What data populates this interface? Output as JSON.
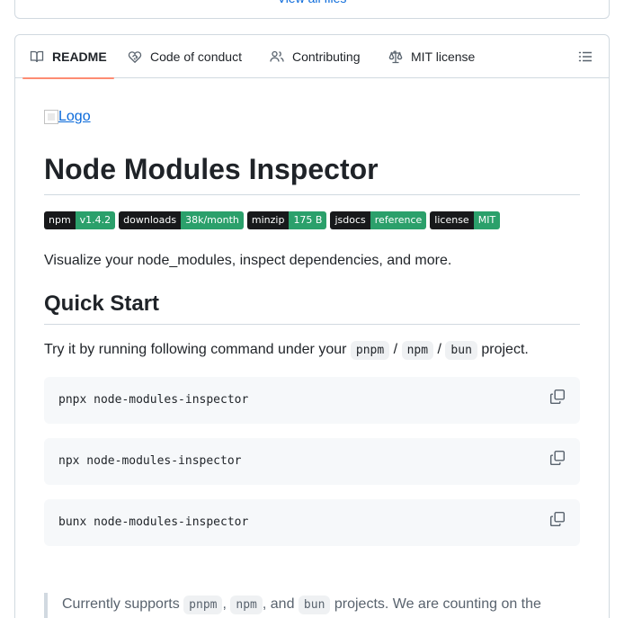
{
  "top": {
    "view_all_files": "View all files"
  },
  "tabs": [
    {
      "label": "README",
      "icon": "book-icon"
    },
    {
      "label": "Code of conduct",
      "icon": "heart-handshake-icon"
    },
    {
      "label": "Contributing",
      "icon": "people-icon"
    },
    {
      "label": "MIT license",
      "icon": "law-scale-icon"
    }
  ],
  "toc_icon": "list-unordered-icon",
  "readme": {
    "logo_alt": "Logo",
    "title": "Node Modules Inspector",
    "badges": [
      {
        "label": "npm",
        "value": "v1.4.2"
      },
      {
        "label": "downloads",
        "value": "38k/month"
      },
      {
        "label": "minzip",
        "value": "175 B"
      },
      {
        "label": "jsdocs",
        "value": "reference"
      },
      {
        "label": "license",
        "value": "MIT"
      }
    ],
    "badge_colors": {
      "label_bg": "#18191b",
      "value_bg": "#2ba06b"
    },
    "description": "Visualize your node_modules, inspect dependencies, and more.",
    "quick_start": {
      "heading": "Quick Start",
      "intro_before": "Try it by running following command under your",
      "pm1": "pnpm",
      "sep1": "/",
      "pm2": "npm",
      "sep2": "/",
      "pm3": "bun",
      "intro_after": "project.",
      "commands": [
        "pnpx node-modules-inspector",
        "npx node-modules-inspector",
        "bunx node-modules-inspector"
      ]
    },
    "note": {
      "before": "Currently supports",
      "pm1": "pnpm",
      "comma": ",",
      "pm2": "npm",
      "and": ", and",
      "pm3": "bun",
      "after": "projects. We are counting on the community to bring support for other package managers."
    }
  }
}
